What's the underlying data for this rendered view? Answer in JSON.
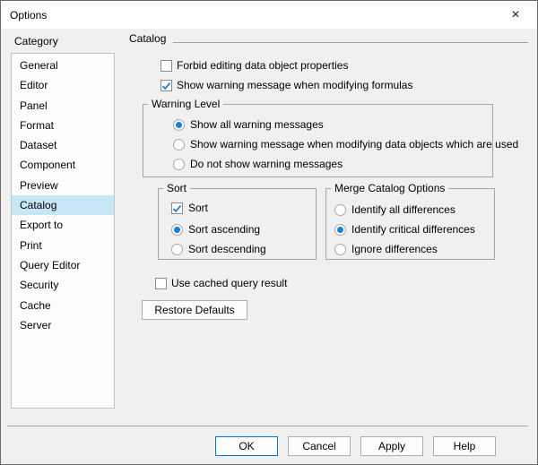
{
  "window": {
    "title": "Options",
    "close_glyph": "×"
  },
  "sidebar": {
    "label": "Category",
    "items": [
      {
        "label": "General",
        "selected": false
      },
      {
        "label": "Editor",
        "selected": false
      },
      {
        "label": "Panel",
        "selected": false
      },
      {
        "label": "Format",
        "selected": false
      },
      {
        "label": "Dataset",
        "selected": false
      },
      {
        "label": "Component",
        "selected": false
      },
      {
        "label": "Preview",
        "selected": false
      },
      {
        "label": "Catalog",
        "selected": true
      },
      {
        "label": "Export to",
        "selected": false
      },
      {
        "label": "Print",
        "selected": false
      },
      {
        "label": "Query Editor",
        "selected": false
      },
      {
        "label": "Security",
        "selected": false
      },
      {
        "label": "Cache",
        "selected": false
      },
      {
        "label": "Server",
        "selected": false
      }
    ]
  },
  "content": {
    "section_title": "Catalog",
    "forbid_editing": {
      "label": "Forbid editing data object properties",
      "checked": false
    },
    "show_warning": {
      "label": "Show warning message when modifying formulas",
      "checked": true
    },
    "warning_level": {
      "title": "Warning Level",
      "options": [
        {
          "label": "Show all warning messages",
          "selected": true
        },
        {
          "label": "Show warning message when modifying data objects which are used",
          "selected": false
        },
        {
          "label": "Do not show warning messages",
          "selected": false
        }
      ]
    },
    "sort": {
      "title": "Sort",
      "sort_checkbox": {
        "label": "Sort",
        "checked": true
      },
      "options": [
        {
          "label": "Sort ascending",
          "selected": true
        },
        {
          "label": "Sort descending",
          "selected": false
        }
      ]
    },
    "merge": {
      "title": "Merge Catalog Options",
      "options": [
        {
          "label": "Identify all differences",
          "selected": false
        },
        {
          "label": "Identify critical differences",
          "selected": true
        },
        {
          "label": "Ignore differences",
          "selected": false
        }
      ]
    },
    "use_cached": {
      "label": "Use cached query result",
      "checked": false
    },
    "restore_defaults_label": "Restore Defaults"
  },
  "footer": {
    "ok_label": "OK",
    "cancel_label": "Cancel",
    "apply_label": "Apply",
    "help_label": "Help"
  },
  "colors": {
    "accent": "#0078d7",
    "check_blue": "#1a7fd6",
    "radio_blue": "#1081d7",
    "selection_blue": "#c8e6f6",
    "dialog_bg": "#f0f0f0",
    "titlebar_bg": "#ffffff",
    "border_gray": "#a6a6a6"
  }
}
